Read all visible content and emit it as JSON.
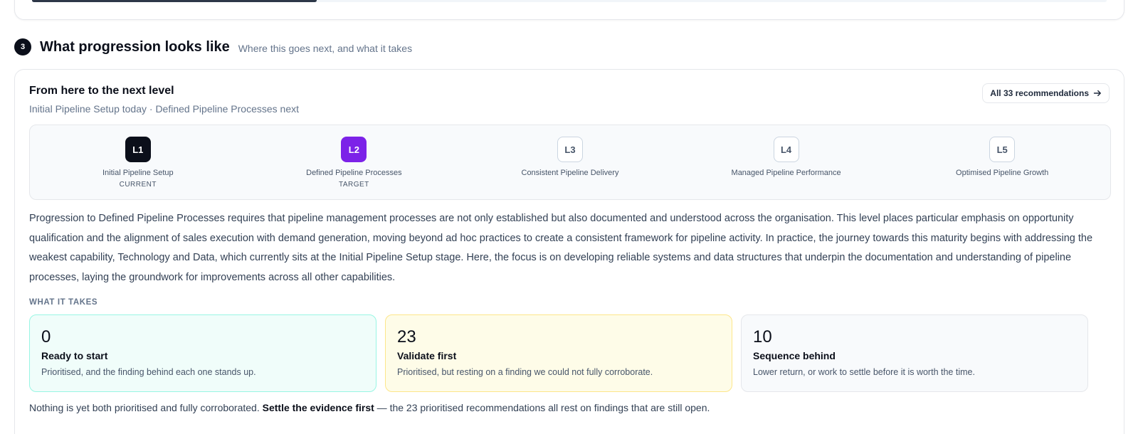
{
  "section": {
    "number": "3",
    "title": "What progression looks like",
    "subtitle": "Where this goes next, and what it takes"
  },
  "previous_progress": 0.265,
  "card": {
    "title": "From here to the next level",
    "subtitle": "Initial Pipeline Setup today · Defined Pipeline Processes next",
    "all_button_label": "All 33 recommendations",
    "all_button_icon": "arrow-right-icon"
  },
  "levels": [
    {
      "code": "L1",
      "name": "Initial Pipeline Setup",
      "tag": "CURRENT",
      "state": "current"
    },
    {
      "code": "L2",
      "name": "Defined Pipeline Processes",
      "tag": "TARGET",
      "state": "target"
    },
    {
      "code": "L3",
      "name": "Consistent Pipeline Delivery",
      "tag": "",
      "state": "future"
    },
    {
      "code": "L4",
      "name": "Managed Pipeline Performance",
      "tag": "",
      "state": "future"
    },
    {
      "code": "L5",
      "name": "Optimised Pipeline Growth",
      "tag": "",
      "state": "future"
    }
  ],
  "narrative": "Progression to Defined Pipeline Processes requires that pipeline management processes are not only established but also documented and understood across the organisation. This level places particular emphasis on opportunity qualification and the alignment of sales execution with demand generation, moving beyond ad hoc practices to create a consistent framework for pipeline activity. In practice, the journey towards this maturity begins with addressing the weakest capability, Technology and Data, which currently sits at the Initial Pipeline Setup stage. Here, the focus is on developing reliable systems and data structures that underpin the documentation and understanding of pipeline processes, laying the groundwork for improvements across all other capabilities.",
  "what_it_takes": {
    "label": "WHAT IT TAKES",
    "tiles": [
      {
        "count": "0",
        "title": "Ready to start",
        "desc": "Prioritised, and the finding behind each one stands up."
      },
      {
        "count": "23",
        "title": "Validate first",
        "desc": "Prioritised, but resting on a finding we could not fully corroborate."
      },
      {
        "count": "10",
        "title": "Sequence behind",
        "desc": "Lower return, or work to settle before it is worth the time."
      }
    ]
  },
  "footnote": {
    "lead": "Nothing is yet both prioritised and fully corroborated. ",
    "emphasis": "Settle the evidence first",
    "tail": " — the 23 prioritised recommendations all rest on findings that are still open."
  },
  "colors": {
    "current": "#0b0f1a",
    "target": "#7c22e8",
    "ready_bg": "#f0fdfa",
    "validate_bg": "#fefce8"
  }
}
